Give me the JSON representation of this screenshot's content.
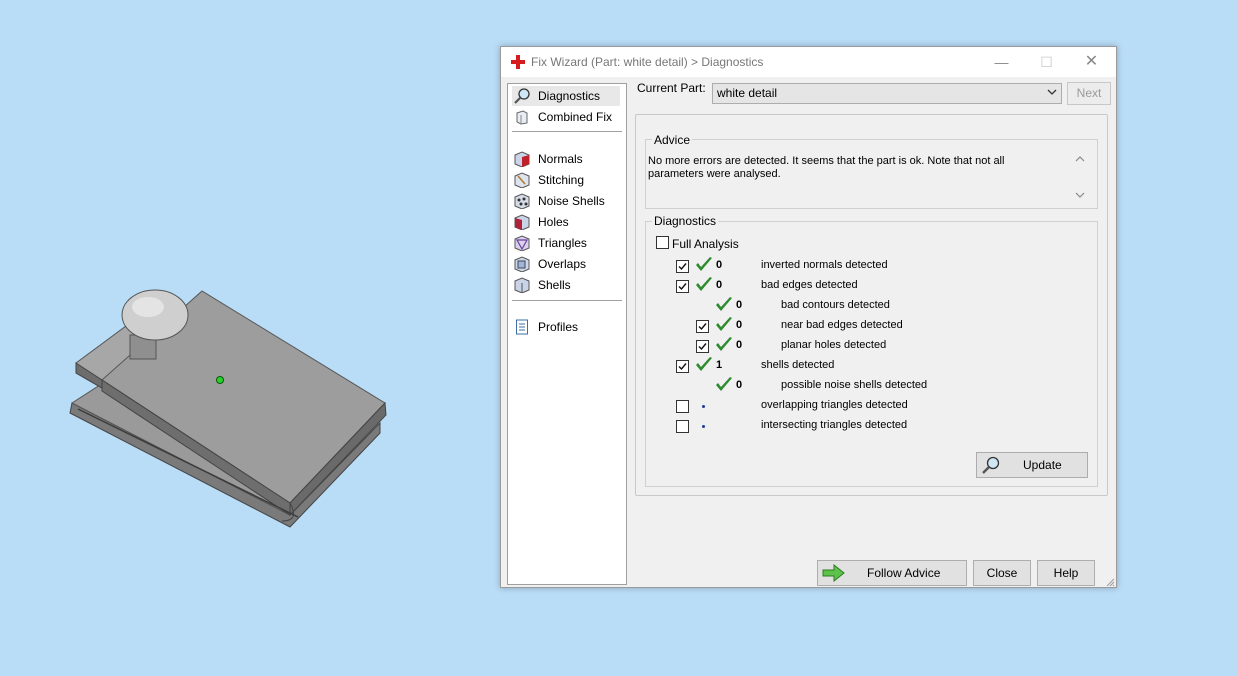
{
  "window": {
    "title": "Fix Wizard (Part: white detail) > Diagnostics",
    "minimize_glyph": "—",
    "maximize_glyph": "☐",
    "close_glyph": "✕"
  },
  "sidebar": {
    "items": [
      {
        "label": "Diagnostics",
        "icon": "magnifier-icon"
      },
      {
        "label": "Combined Fix",
        "icon": "combined-fix-icon"
      },
      {
        "label": "Normals",
        "icon": "normals-icon"
      },
      {
        "label": "Stitching",
        "icon": "stitching-icon"
      },
      {
        "label": "Noise Shells",
        "icon": "noise-shells-icon"
      },
      {
        "label": "Holes",
        "icon": "holes-icon"
      },
      {
        "label": "Triangles",
        "icon": "triangles-icon"
      },
      {
        "label": "Overlaps",
        "icon": "overlaps-icon"
      },
      {
        "label": "Shells",
        "icon": "shells-icon"
      },
      {
        "label": "Profiles",
        "icon": "profiles-icon"
      }
    ]
  },
  "header": {
    "current_part_label": "Current Part:",
    "current_part_value": "white detail",
    "next_label": "Next"
  },
  "advice": {
    "title": "Advice",
    "text": "No more errors are detected. It seems that the part is ok. Note that not all parameters were analysed."
  },
  "diagnostics": {
    "title": "Diagnostics",
    "full_analysis_label": "Full Analysis",
    "full_analysis_checked": false,
    "rows": [
      {
        "checked": true,
        "ok": true,
        "count": "0",
        "label": "inverted normals detected",
        "indent": 0
      },
      {
        "checked": true,
        "ok": true,
        "count": "0",
        "label": "bad edges detected",
        "indent": 0
      },
      {
        "checked": null,
        "ok": true,
        "count": "0",
        "label": "bad contours detected",
        "indent": 1
      },
      {
        "checked": true,
        "ok": true,
        "count": "0",
        "label": "near bad edges detected",
        "indent": 1
      },
      {
        "checked": true,
        "ok": true,
        "count": "0",
        "label": "planar holes detected",
        "indent": 1
      },
      {
        "checked": true,
        "ok": true,
        "count": "1",
        "label": "shells detected",
        "indent": 0
      },
      {
        "checked": null,
        "ok": true,
        "count": "0",
        "label": "possible noise shells detected",
        "indent": 1
      },
      {
        "checked": false,
        "ok": false,
        "count": "",
        "label": "overlapping triangles detected",
        "indent": 0
      },
      {
        "checked": false,
        "ok": false,
        "count": "",
        "label": "intersecting triangles detected",
        "indent": 0
      }
    ],
    "update_label": "Update"
  },
  "footer": {
    "follow_advice_label": "Follow Advice",
    "close_label": "Close",
    "help_label": "Help"
  },
  "colors": {
    "desktop_bg": "#b9dcf7",
    "check_green": "#2e8b2e",
    "dialog_bg": "#f0f0f0"
  }
}
